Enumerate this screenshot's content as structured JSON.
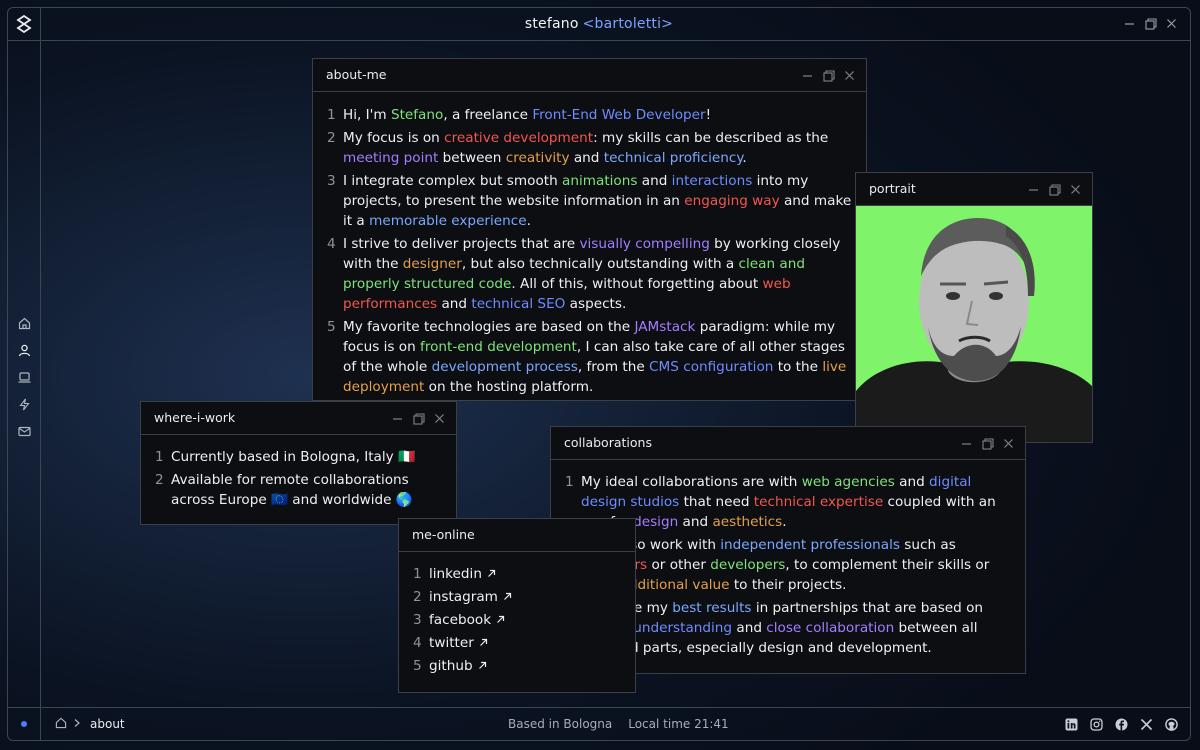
{
  "header": {
    "first_name": "stefano",
    "last_name": "<bartoletti>"
  },
  "windows": {
    "about": {
      "title": "about-me",
      "lines": [
        {
          "n": "1",
          "parts": [
            [
              "t",
              "Hi, I'm "
            ],
            [
              "g",
              "Stefano"
            ],
            [
              "t",
              ", a freelance "
            ],
            [
              "b",
              "Front-End Web Developer"
            ],
            [
              "t",
              "!"
            ]
          ]
        },
        {
          "n": "2",
          "parts": [
            [
              "t",
              "My focus is on "
            ],
            [
              "r",
              "creative development"
            ],
            [
              "t",
              ": my skills can be described as the "
            ],
            [
              "p",
              "meeting point"
            ],
            [
              "t",
              " between "
            ],
            [
              "o",
              "creativity"
            ],
            [
              "t",
              " and "
            ],
            [
              "lb",
              "technical proficiency"
            ],
            [
              "t",
              "."
            ]
          ]
        },
        {
          "n": "3",
          "parts": [
            [
              "t",
              "I integrate complex but smooth "
            ],
            [
              "g",
              "animations"
            ],
            [
              "t",
              " and "
            ],
            [
              "b",
              "interactions"
            ],
            [
              "t",
              " into my projects, to present the website information in an "
            ],
            [
              "r",
              "engaging way"
            ],
            [
              "t",
              " and make it a "
            ],
            [
              "lb",
              "memorable experience"
            ],
            [
              "t",
              "."
            ]
          ]
        },
        {
          "n": "4",
          "parts": [
            [
              "t",
              "I strive to deliver projects that are "
            ],
            [
              "p",
              "visually compelling"
            ],
            [
              "t",
              " by working closely with the "
            ],
            [
              "o",
              "designer"
            ],
            [
              "t",
              ", but also technically outstanding with a "
            ],
            [
              "g",
              "clean and properly structured code"
            ],
            [
              "t",
              ". All of this, without forgetting about "
            ],
            [
              "r",
              "web performances"
            ],
            [
              "t",
              " and "
            ],
            [
              "b",
              "technical SEO"
            ],
            [
              "t",
              " aspects."
            ]
          ]
        },
        {
          "n": "5",
          "parts": [
            [
              "t",
              "My favorite technologies are based on the "
            ],
            [
              "p",
              "JAMstack"
            ],
            [
              "t",
              " paradigm: while my focus is on "
            ],
            [
              "g",
              "front-end development"
            ],
            [
              "t",
              ", I can also take care of all other stages of the whole "
            ],
            [
              "lb",
              "development process"
            ],
            [
              "t",
              ", from the "
            ],
            [
              "b",
              "CMS configuration"
            ],
            [
              "t",
              " to the "
            ],
            [
              "o",
              "live deployment"
            ],
            [
              "t",
              " on the hosting platform."
            ]
          ]
        }
      ]
    },
    "portrait": {
      "title": "portrait"
    },
    "where": {
      "title": "where-i-work",
      "lines": [
        {
          "n": "1",
          "parts": [
            [
              "t",
              "Currently based in Bologna, Italy 🇮🇹"
            ]
          ]
        },
        {
          "n": "2",
          "parts": [
            [
              "t",
              "Available for remote collaborations across Europe 🇪🇺 and worldwide 🌎"
            ]
          ]
        }
      ]
    },
    "collab": {
      "title": "collaborations",
      "lines": [
        {
          "n": "1",
          "parts": [
            [
              "t",
              "My ideal collaborations are with "
            ],
            [
              "g",
              "web agencies"
            ],
            [
              "t",
              " and "
            ],
            [
              "b",
              "digital design studios"
            ],
            [
              "t",
              " that need "
            ],
            [
              "r",
              "technical expertise"
            ],
            [
              "t",
              " coupled with an eye for "
            ],
            [
              "p",
              "design"
            ],
            [
              "t",
              " and "
            ],
            [
              "o",
              "aesthetics"
            ],
            [
              "t",
              "."
            ]
          ]
        },
        {
          "n": "2",
          "parts": [
            [
              "t",
              "I can also work with "
            ],
            [
              "lb",
              "independent professionals"
            ],
            [
              "t",
              " such as "
            ],
            [
              "r",
              "designers"
            ],
            [
              "t",
              " or other "
            ],
            [
              "g",
              "developers"
            ],
            [
              "t",
              ", to complement their skills or bring "
            ],
            [
              "o",
              "additional value"
            ],
            [
              "t",
              " to their projects."
            ]
          ]
        },
        {
          "n": "3",
          "parts": [
            [
              "t",
              "I achieve my "
            ],
            [
              "lb",
              "best results"
            ],
            [
              "t",
              " in partnerships that are based on "
            ],
            [
              "b",
              "mutual understanding"
            ],
            [
              "t",
              " and "
            ],
            [
              "p",
              "close collaboration"
            ],
            [
              "t",
              " between all involved parts, especially design and development."
            ]
          ]
        }
      ]
    },
    "online": {
      "title": "me-online",
      "links": [
        {
          "n": "1",
          "label": "linkedin"
        },
        {
          "n": "2",
          "label": "instagram"
        },
        {
          "n": "3",
          "label": "facebook"
        },
        {
          "n": "4",
          "label": "twitter"
        },
        {
          "n": "5",
          "label": "github"
        }
      ]
    }
  },
  "footer": {
    "breadcrumb": "about",
    "based": "Based in Bologna",
    "local_time": "Local time 21:41"
  },
  "colors": {
    "green": "#7fe27a",
    "blue": "#6e8cff",
    "red": "#f2584f",
    "purple": "#a57dff",
    "orange": "#e5a04c",
    "light_blue": "#79a9ff",
    "accent": "#4f7cff"
  }
}
